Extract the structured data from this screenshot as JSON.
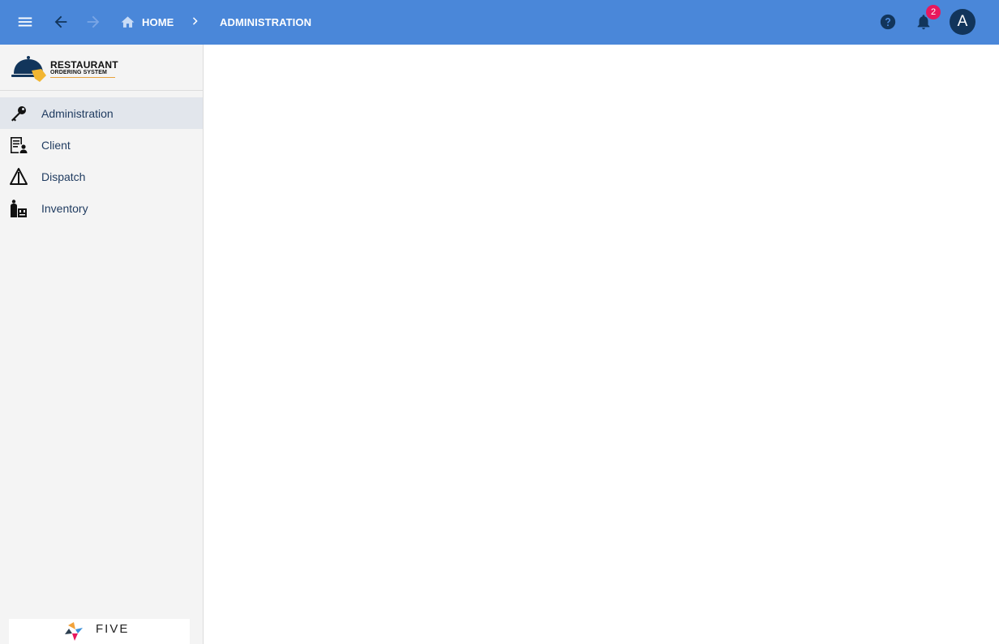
{
  "header": {
    "breadcrumb_home": "HOME",
    "breadcrumb_current": "ADMINISTRATION",
    "notification_count": "2",
    "avatar_initial": "A",
    "colors": {
      "bar": "#4a87d9",
      "badge": "#e8175d",
      "avatar": "#12355b"
    }
  },
  "icons": {
    "menu": "menu-icon",
    "back": "arrow-left-icon",
    "forward": "arrow-right-icon",
    "home": "home-icon",
    "separator": "chevron-right-icon",
    "help": "help-icon",
    "bell": "bell-icon"
  },
  "brand": {
    "line1": "RESTAURANT",
    "line2": "ORDERING SYSTEM",
    "footer": "FIVE"
  },
  "sidebar": {
    "items": [
      {
        "label": "Administration",
        "icon": "key-icon",
        "active": true
      },
      {
        "label": "Client",
        "icon": "client-list-icon",
        "active": false
      },
      {
        "label": "Dispatch",
        "icon": "dispatch-icon",
        "active": false
      },
      {
        "label": "Inventory",
        "icon": "inventory-icon",
        "active": false
      }
    ]
  }
}
